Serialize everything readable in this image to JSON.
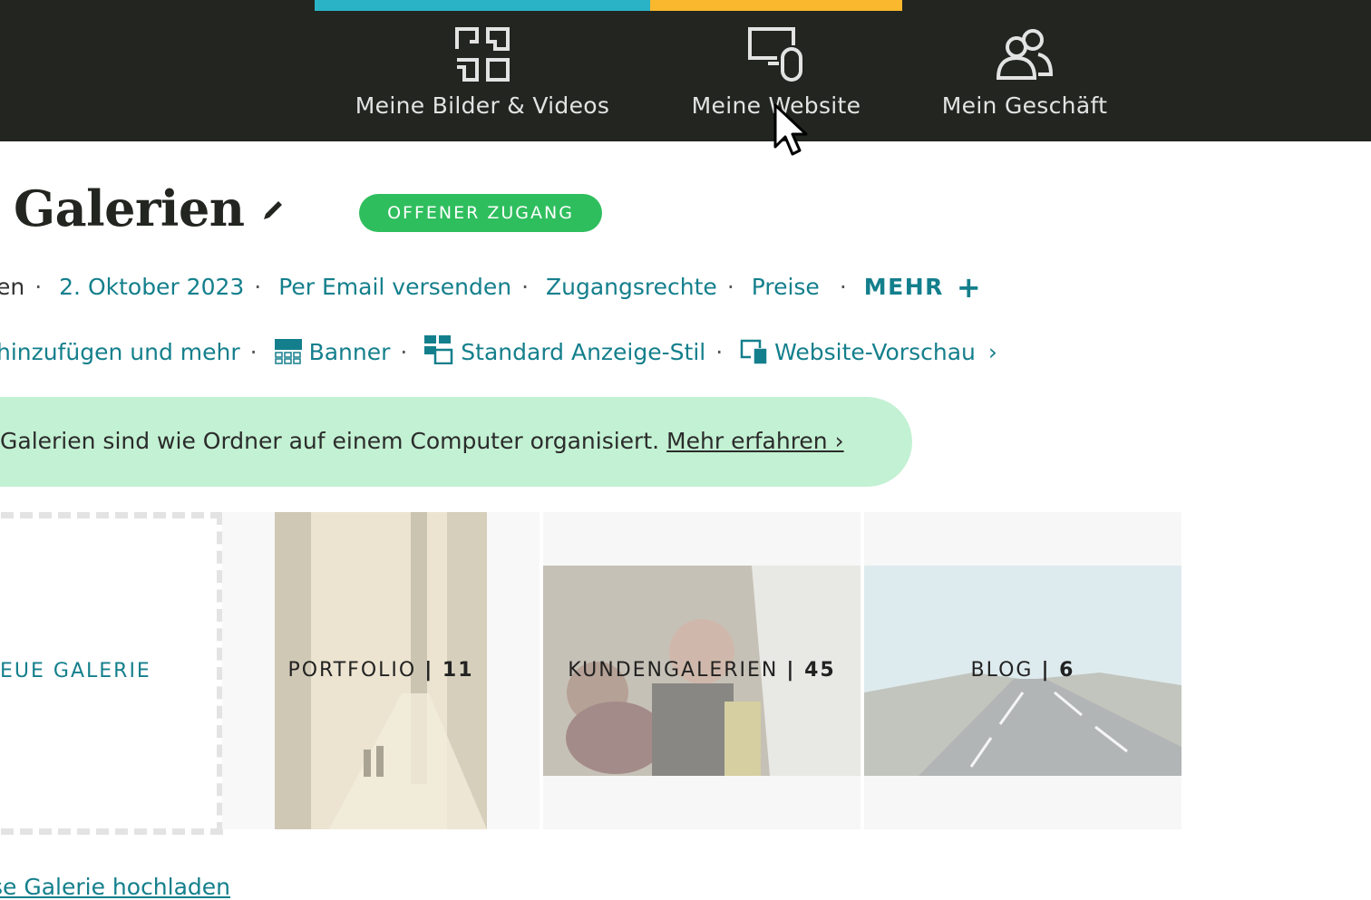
{
  "nav": {
    "items": [
      {
        "label": "Meine Bilder & Videos",
        "icon": "grid-icon"
      },
      {
        "label": "Meine Website",
        "icon": "devices-icon"
      },
      {
        "label": "Mein Geschäft",
        "icon": "users-icon"
      }
    ],
    "accent_colors": [
      "#2ab3c6",
      "#f9b82e"
    ]
  },
  "page": {
    "title": "Galerien",
    "access_badge": "OFFENER ZUGANG"
  },
  "meta": {
    "cut_prefix": "en",
    "date": "2. Oktober 2023",
    "email": "Per Email versenden",
    "access": "Zugangsrechte",
    "prices": "Preise",
    "more": "MEHR",
    "more_icon": "+"
  },
  "tools": {
    "add_more": "hinzufügen und mehr",
    "banner": "Banner",
    "display_style": "Standard Anzeige-Stil",
    "website_preview": "Website-Vorschau",
    "chevron": "›"
  },
  "info": {
    "text": "Galerien sind wie Ordner auf einem Computer organisiert.",
    "link": "Mehr erfahren ›"
  },
  "galleries": {
    "new_label": "EUE GALERIE",
    "items": [
      {
        "name": "PORTFOLIO",
        "count": "| 11"
      },
      {
        "name": "KUNDENGALERIEN",
        "count": "| 45"
      },
      {
        "name": "BLOG",
        "count": "| 6"
      }
    ]
  },
  "bottom_link": "se Galerie hochladen",
  "colors": {
    "brand": "#147f8c",
    "badge": "#2fbe5e",
    "info_bg": "#c3f1d3",
    "topbar": "#222520"
  }
}
